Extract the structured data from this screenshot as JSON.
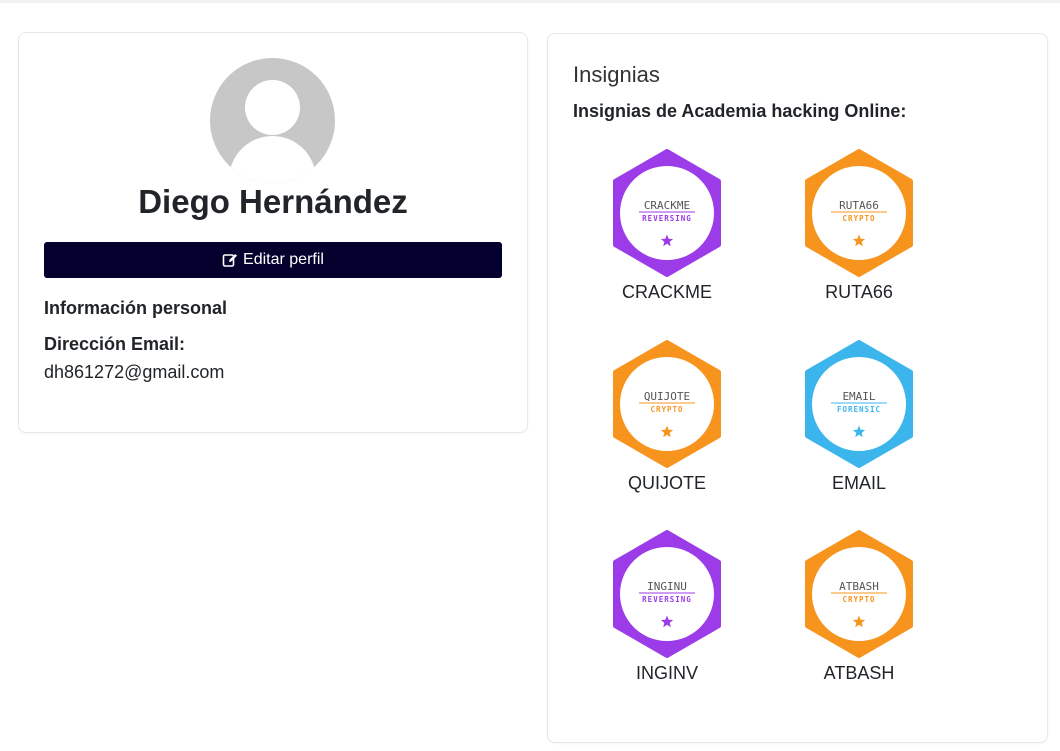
{
  "profile": {
    "name": "Diego Hernández",
    "edit_button_label": "Editar perfil",
    "personal_info_heading": "Información personal",
    "email_label": "Dirección Email:",
    "email_value": "dh861272@gmail.com"
  },
  "badges": {
    "title": "Insignias",
    "subtitle": "Insignias de Academia hacking Online:",
    "items": [
      {
        "name": "CRACKME",
        "emblem_title": "CRACKME",
        "category": "REVERSING",
        "color": "#9b3ce8"
      },
      {
        "name": "RUTA66",
        "emblem_title": "RUTA66",
        "category": "CRYPTO",
        "color": "#f7941d"
      },
      {
        "name": "QUIJOTE",
        "emblem_title": "QUIJOTE",
        "category": "CRYPTO",
        "color": "#f7941d"
      },
      {
        "name": "EMAIL",
        "emblem_title": "EMAIL",
        "category": "FORENSIC",
        "color": "#3bb5ec"
      },
      {
        "name": "INGINV",
        "emblem_title": "INGINU",
        "category": "REVERSING",
        "color": "#9b3ce8"
      },
      {
        "name": "ATBASH",
        "emblem_title": "ATBASH",
        "category": "CRYPTO",
        "color": "#f7941d"
      }
    ]
  }
}
